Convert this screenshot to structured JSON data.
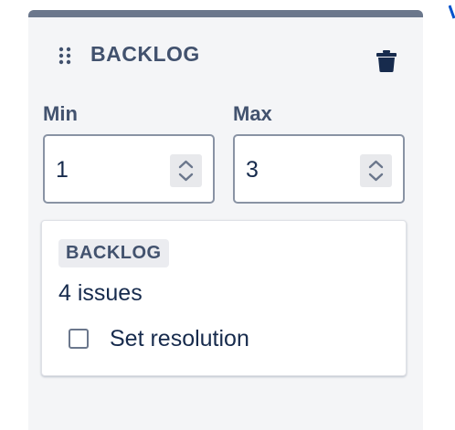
{
  "column": {
    "title": "BACKLOG",
    "topbar_color": "#6b778c",
    "drag_icon": "drag-handle-icon",
    "delete_icon": "trash-icon"
  },
  "limits": {
    "min_label": "Min",
    "min_value": "1",
    "max_label": "Max",
    "max_value": "3"
  },
  "status_card": {
    "status_name": "BACKLOG",
    "issue_count": "4 issues",
    "checkbox_label": "Set resolution",
    "checkbox_checked": false
  }
}
